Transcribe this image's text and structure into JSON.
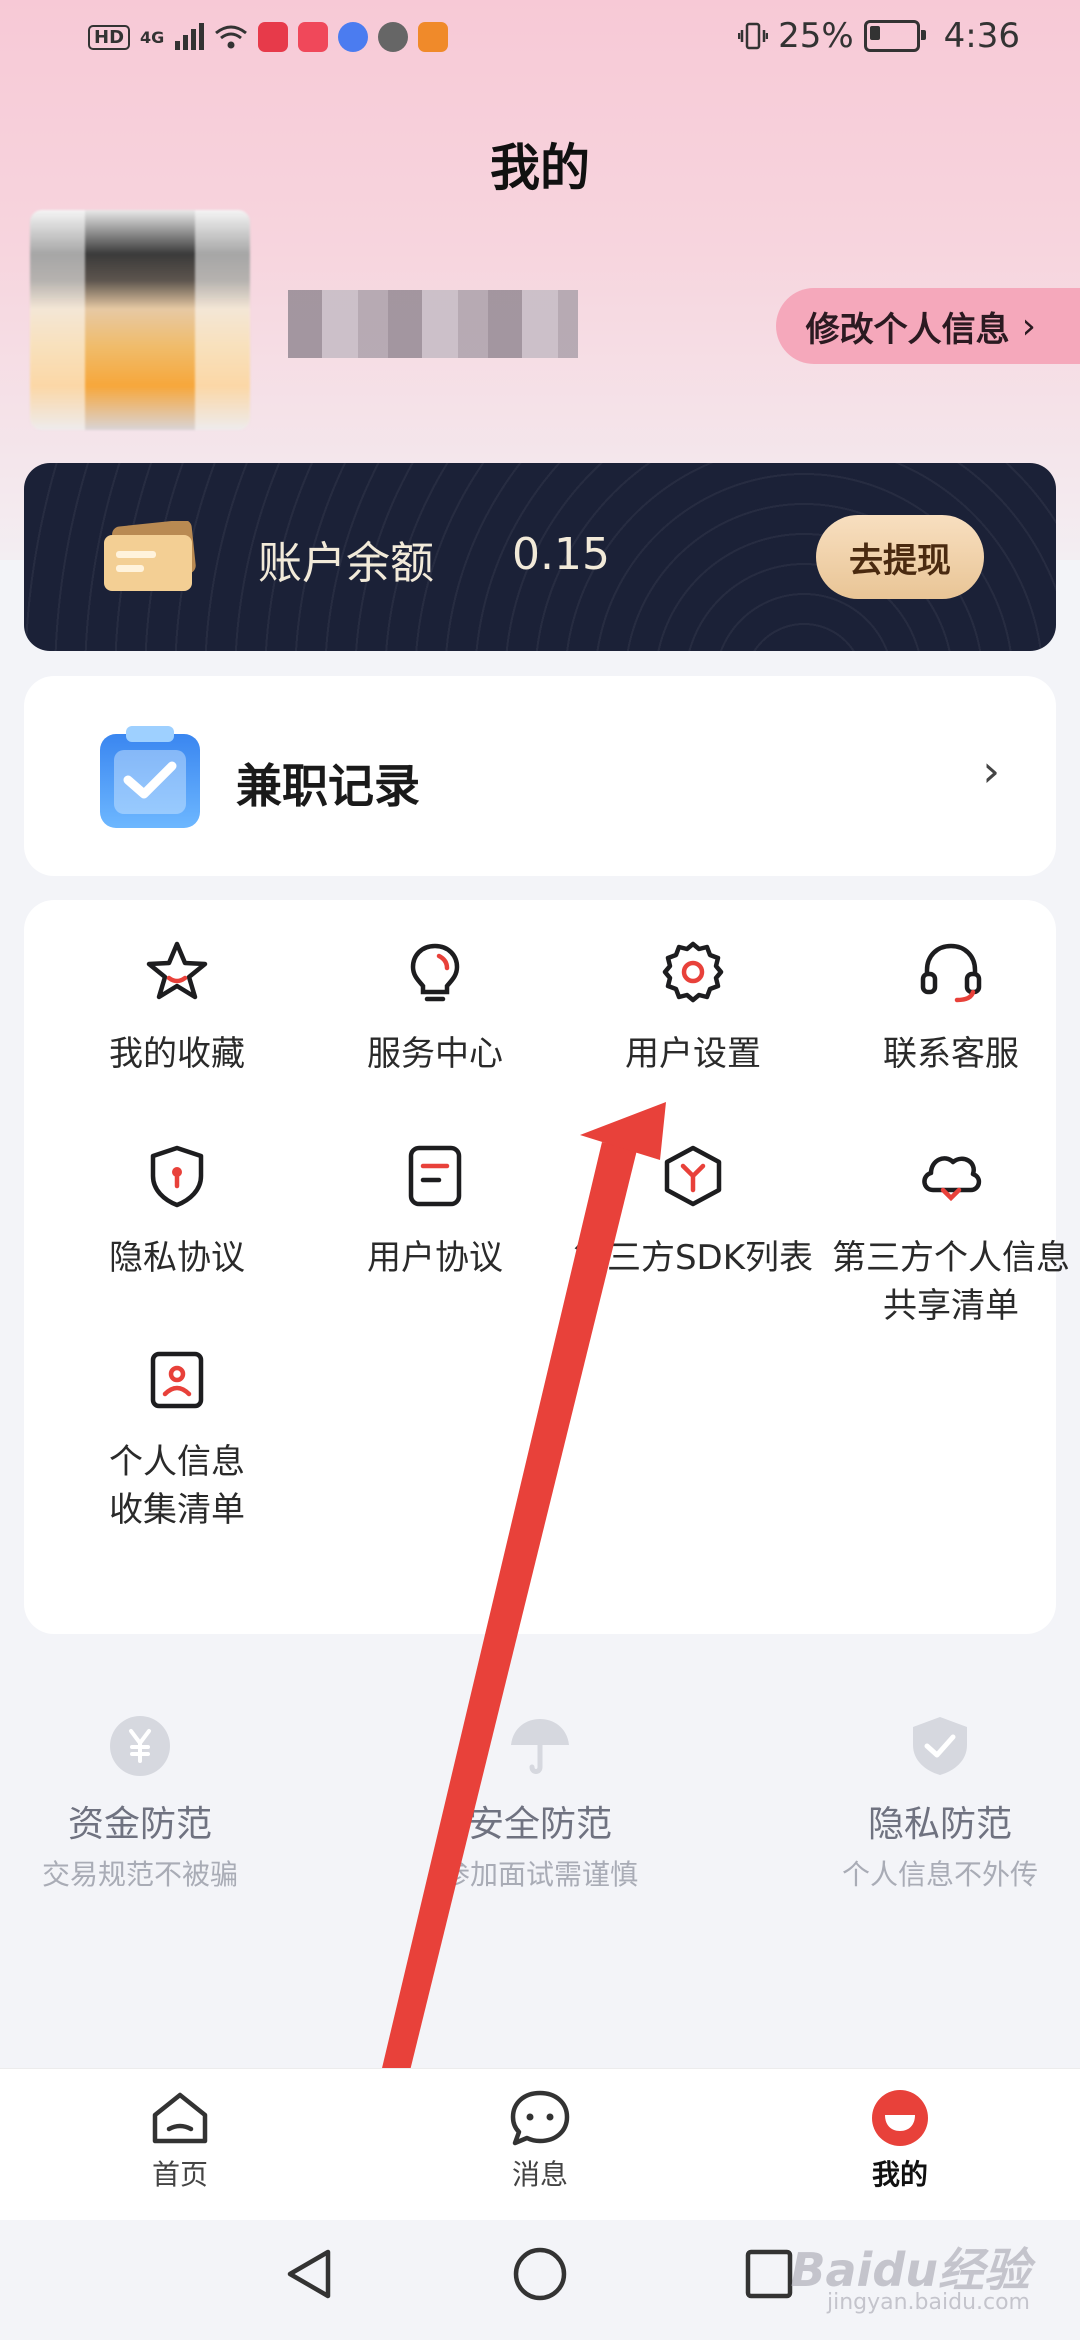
{
  "status_bar": {
    "hd": "HD",
    "network": "4G",
    "battery_percent": "25%",
    "time": "4:36"
  },
  "header": {
    "title": "我的"
  },
  "profile": {
    "edit_label": "修改个人信息"
  },
  "balance": {
    "label": "账户余额",
    "value": "0.15",
    "withdraw_label": "去提现"
  },
  "records": {
    "label": "兼职记录"
  },
  "grid": [
    {
      "label": "我的收藏",
      "icon": "star-icon"
    },
    {
      "label": "服务中心",
      "icon": "bulb-icon"
    },
    {
      "label": "用户设置",
      "icon": "gear-icon"
    },
    {
      "label": "联系客服",
      "icon": "headset-icon"
    },
    {
      "label": "隐私协议",
      "icon": "shield-icon"
    },
    {
      "label": "用户协议",
      "icon": "document-icon"
    },
    {
      "label": "第三方SDK列表",
      "icon": "cube-icon"
    },
    {
      "label": "第三方个人信息共享清单",
      "icon": "cloud-icon"
    },
    {
      "label": "个人信息收集清单",
      "icon": "person-card-icon"
    }
  ],
  "safety": [
    {
      "title": "资金防范",
      "subtitle": "交易规范不被骗",
      "icon": "yen-icon"
    },
    {
      "title": "安全防范",
      "subtitle": "参加面试需谨慎",
      "icon": "umbrella-icon"
    },
    {
      "title": "隐私防范",
      "subtitle": "个人信息不外传",
      "icon": "shield-check-icon"
    }
  ],
  "tabs": [
    {
      "label": "首页",
      "icon": "home-icon"
    },
    {
      "label": "消息",
      "icon": "message-icon"
    },
    {
      "label": "我的",
      "icon": "profile-icon",
      "active": true
    }
  ],
  "watermark": {
    "text": "Baidu经验",
    "sub": "jingyan.baidu.com"
  },
  "colors": {
    "accent": "#e8413a",
    "balance_card_bg": "#1b2137",
    "edit_button_bg": "#f5a8bb",
    "annotation_arrow": "#e8413a"
  }
}
